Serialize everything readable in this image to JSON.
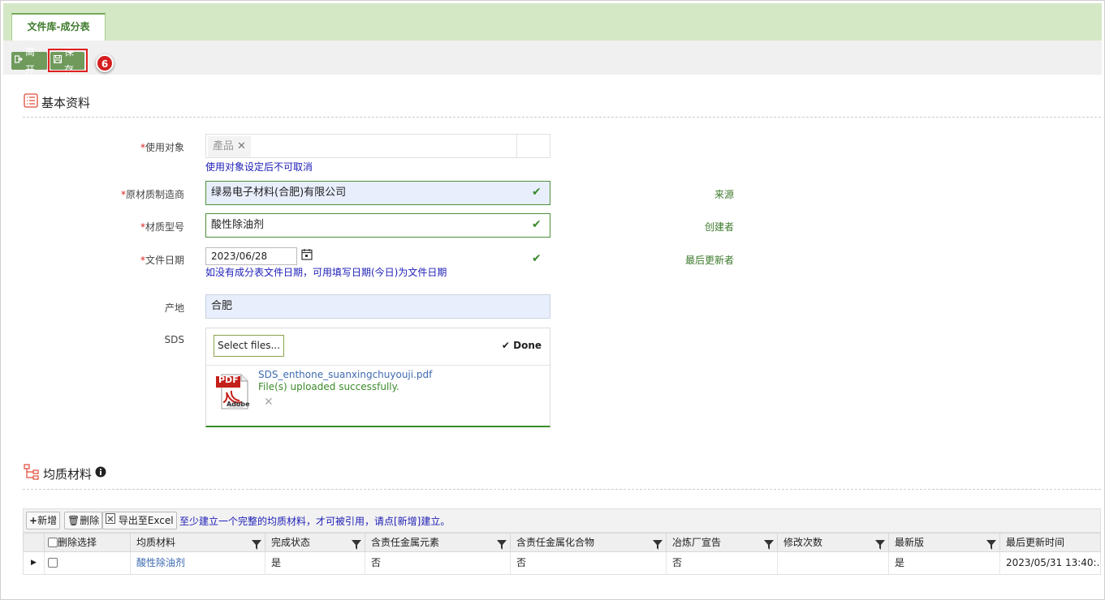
{
  "tab": {
    "label": "文件库-成分表"
  },
  "toolbar": {
    "leave_label": "离开",
    "save_label": "保存",
    "step_badge": "6"
  },
  "basic": {
    "title": "基本资料",
    "use_target": {
      "label": "使用对象",
      "token": "產品",
      "hint": "使用对象设定后不可取消"
    },
    "manufacturer": {
      "label": "原材质制造商",
      "value": "绿易电子材料(合肥)有限公司"
    },
    "model": {
      "label": "材质型号",
      "value": "酸性除油剂"
    },
    "doc_date": {
      "label": "文件日期",
      "value": "2023/06/28",
      "hint": "如没有成分表文件日期，可用填写日期(今日)为文件日期"
    },
    "origin": {
      "label": "产地",
      "value": "合肥"
    },
    "sds": {
      "label": "SDS",
      "select_label": "Select files...",
      "done_label": "Done",
      "file_name": "SDS_enthone_suanxingchuyouji.pdf",
      "file_status": "File(s) uploaded successfully."
    },
    "right_labels": {
      "source": "来源",
      "creator": "创建者",
      "last_updater": "最后更新者"
    }
  },
  "materials": {
    "title": "均质材料",
    "toolbar": {
      "add_label": "新增",
      "delete_label": "删除",
      "export_label": "导出至Excel",
      "hint": "至少建立一个完整的均质材料，才可被引用，请点[新增]建立。"
    },
    "columns": [
      "删除选择",
      "均质材料",
      "完成状态",
      "含责任金属元素",
      "含责任金属化合物",
      "冶炼厂宣告",
      "修改次数",
      "最新版",
      "最后更新时间"
    ],
    "rows": [
      {
        "material": "酸性除油剂",
        "status": "是",
        "metal": "否",
        "compound": "否",
        "smelter": "否",
        "revisions": "",
        "latest": "是",
        "updated": "2023/05/31 13:40:..."
      }
    ]
  },
  "colors": {
    "accent_green": "#6f9a5c",
    "tab_bar": "#d4e8c6",
    "required": "#e02020",
    "hint_blue": "#2020b8"
  }
}
